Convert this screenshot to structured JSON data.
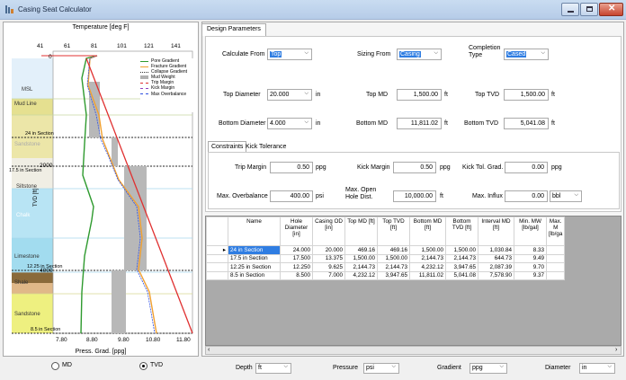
{
  "window": {
    "title": "Casing Seat Calculator"
  },
  "left": {
    "top_axis_title": "Temperature [deg F]",
    "top_ticks": [
      "41",
      "61",
      "81",
      "101",
      "121",
      "141"
    ],
    "bottom_axis_title": "Press. Grad. [ppg]",
    "bottom_ticks": [
      "7.80",
      "8.80",
      "9.80",
      "10.80",
      "11.80"
    ],
    "y_label": "TVD [ft]",
    "y_ticks": [
      "0",
      "2000",
      "4000"
    ],
    "formations": [
      "MSL",
      "Mud Line",
      "Sandstone",
      "Siltstone",
      "Chalk",
      "Limestone",
      "Shale",
      "Sandstone"
    ],
    "section_labels": [
      "24 in Section",
      "17.5 in Section",
      "12.25 in Section",
      "8.5 in Section"
    ],
    "legend": [
      {
        "label": "Pore Gradient",
        "color": "#2e9a2e"
      },
      {
        "label": "Fracture Gradient",
        "color": "#f0a030"
      },
      {
        "label": "Collapse Gradient",
        "color": "#333333"
      },
      {
        "label": "Mud Weight",
        "color": "#b0b0b0"
      },
      {
        "label": "Trip Margin",
        "color": "#e03030"
      },
      {
        "label": "Kick Margin",
        "color": "#9040c0"
      },
      {
        "label": "Max Overbalance",
        "color": "#3050e0"
      }
    ],
    "radio_md": "MD",
    "radio_tvd": "TVD"
  },
  "params": {
    "tab": "Design Parameters",
    "calculate_from_label": "Calculate From",
    "calculate_from_value": "Top",
    "sizing_from_label": "Sizing From",
    "sizing_from_value": "Casing",
    "completion_type_label": "Completion Type",
    "completion_type_value": "Cased",
    "top_diameter_label": "Top Diameter",
    "top_diameter_value": "20.000",
    "top_diameter_unit": "in",
    "top_md_label": "Top MD",
    "top_md_value": "1,500.00",
    "top_md_unit": "ft",
    "top_tvd_label": "Top TVD",
    "top_tvd_value": "1,500.00",
    "top_tvd_unit": "ft",
    "bottom_diameter_label": "Bottom Diameter",
    "bottom_diameter_value": "4.000",
    "bottom_diameter_unit": "in",
    "bottom_md_label": "Bottom MD",
    "bottom_md_value": "11,811.02",
    "bottom_md_unit": "ft",
    "bottom_tvd_label": "Bottom TVD",
    "bottom_tvd_value": "5,041.08",
    "bottom_tvd_unit": "ft",
    "subtab_constraints": "Constraints",
    "subtab_kick": "Kick Tolerance",
    "trip_margin_label": "Trip Margin",
    "trip_margin_value": "0.50",
    "trip_margin_unit": "ppg",
    "kick_margin_label": "Kick Margin",
    "kick_margin_value": "0.50",
    "kick_margin_unit": "ppg",
    "kick_tol_label": "Kick Tol. Grad.",
    "kick_tol_value": "0.00",
    "kick_tol_unit": "ppg",
    "max_overbalance_label": "Max. Overbalance",
    "max_overbalance_value": "400.00",
    "max_overbalance_unit": "psi",
    "max_open_hole_label": "Max. Open Hole Dist.",
    "max_open_hole_value": "10,000.00",
    "max_open_hole_unit": "ft",
    "max_influx_label": "Max. Influx",
    "max_influx_value": "0.00",
    "max_influx_unit": "bbl"
  },
  "table": {
    "headers": [
      "Name",
      "Hole Diameter [in]",
      "Casing OD [in]",
      "Top MD [ft]",
      "Top TVD [ft]",
      "Bottom MD [ft]",
      "Bottom TVD [ft]",
      "Interval MD [ft]",
      "Min. MW [lb/gal]",
      "Max. M [lb/ga"
    ],
    "rows": [
      [
        "24 in Section",
        "24.000",
        "20.000",
        "469.16",
        "469.16",
        "1,500.00",
        "1,500.00",
        "1,030.84",
        "8.33",
        ""
      ],
      [
        "17.5 in Section",
        "17.500",
        "13.375",
        "1,500.00",
        "1,500.00",
        "2,144.73",
        "2,144.73",
        "644.73",
        "9.49",
        ""
      ],
      [
        "12.25 in Section",
        "12.250",
        "9.625",
        "2,144.73",
        "2,144.73",
        "4,232.12",
        "3,947.65",
        "2,087.39",
        "9.70",
        ""
      ],
      [
        "8.5 in Section",
        "8.500",
        "7.000",
        "4,232.12",
        "3,947.65",
        "11,811.02",
        "5,041.08",
        "7,578.90",
        "9.37",
        ""
      ]
    ]
  },
  "bottom": {
    "depth_label": "Depth",
    "depth_value": "ft",
    "pressure_label": "Pressure",
    "pressure_value": "psi",
    "gradient_label": "Gradient",
    "gradient_value": "ppg",
    "diameter_label": "Diameter",
    "diameter_value": "in"
  }
}
